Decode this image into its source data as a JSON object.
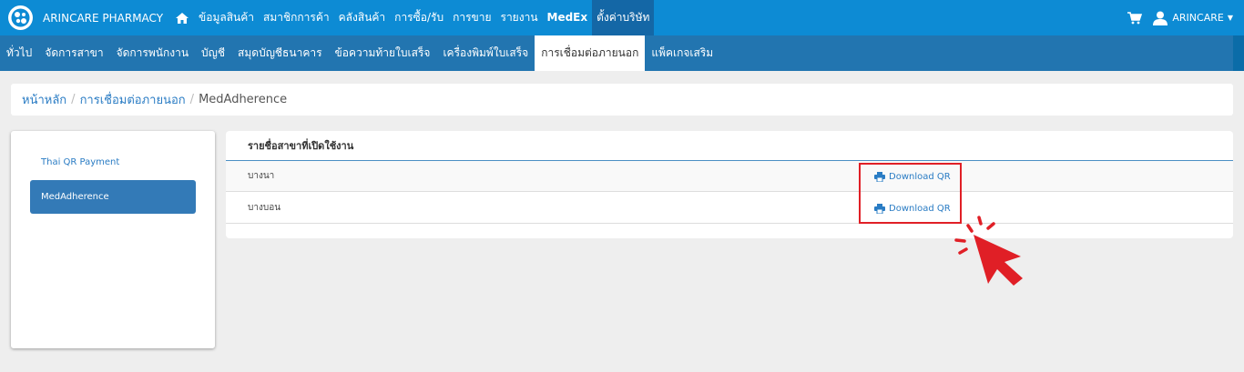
{
  "topbar": {
    "brand": "ARINCARE PHARMACY",
    "menu": [
      {
        "label": "ข้อมูลสินค้า",
        "active": false,
        "bold": false
      },
      {
        "label": "สมาชิกการค้า",
        "active": false,
        "bold": false
      },
      {
        "label": "คลังสินค้า",
        "active": false,
        "bold": false
      },
      {
        "label": "การซื้อ/รับ",
        "active": false,
        "bold": false
      },
      {
        "label": "การขาย",
        "active": false,
        "bold": false
      },
      {
        "label": "รายงาน",
        "active": false,
        "bold": false
      },
      {
        "label": "MedEx",
        "active": false,
        "bold": true
      },
      {
        "label": "ตั้งค่าบริษัท",
        "active": true,
        "bold": false
      }
    ],
    "user": "ARINCARE",
    "colors": {
      "bar": "#0d8bd4",
      "active": "#1467a6"
    }
  },
  "subnav": {
    "items": [
      {
        "label": "ทั่วไป",
        "active": false
      },
      {
        "label": "จัดการสาขา",
        "active": false
      },
      {
        "label": "จัดการพนักงาน",
        "active": false
      },
      {
        "label": "บัญชี",
        "active": false
      },
      {
        "label": "สมุดบัญชีธนาคาร",
        "active": false
      },
      {
        "label": "ข้อความท้ายใบเสร็จ",
        "active": false
      },
      {
        "label": "เครื่องพิมพ์ใบเสร็จ",
        "active": false
      },
      {
        "label": "การเชื่อมต่อภายนอก",
        "active": true
      },
      {
        "label": "แพ็คเกจเสริม",
        "active": false
      }
    ]
  },
  "breadcrumb": {
    "home": "หน้าหลัก",
    "parent": "การเชื่อมต่อภายนอก",
    "current": "MedAdherence",
    "separator": "/"
  },
  "sidebar": {
    "items": [
      {
        "label": "Thai QR Payment",
        "active": false
      },
      {
        "label": "MedAdherence",
        "active": true
      }
    ]
  },
  "table": {
    "header": "รายชื่อสาขาที่เปิดใช้งาน",
    "rows": [
      {
        "name": "บางนา",
        "action": "Download QR"
      },
      {
        "name": "บางบอน",
        "action": "Download QR"
      }
    ]
  },
  "annotation": {
    "highlight_color": "#e01f26"
  }
}
